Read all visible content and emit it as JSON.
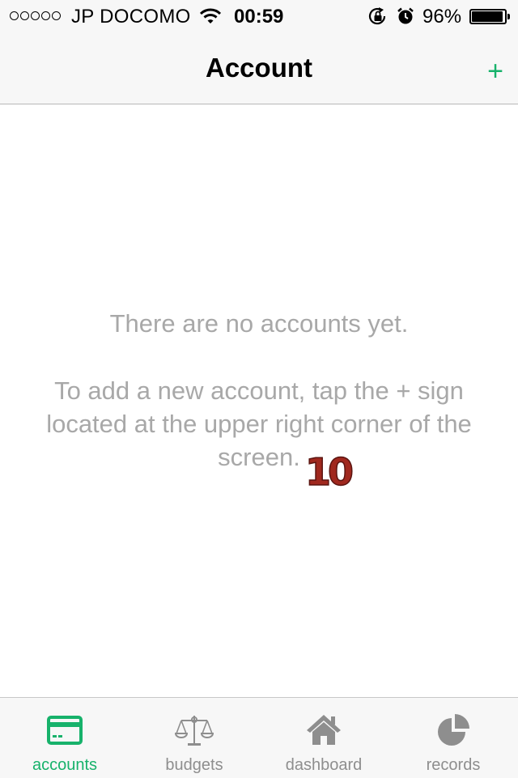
{
  "status_bar": {
    "carrier": "JP DOCOMO",
    "time": "00:59",
    "battery_percent": "96%",
    "battery_level": 0.96,
    "icons": [
      "signal-dots",
      "wifi-icon",
      "rotation-lock-icon",
      "alarm-icon",
      "battery-icon"
    ]
  },
  "nav": {
    "title": "Account",
    "add_label": "+"
  },
  "empty_state": {
    "line1": "There are no accounts yet.",
    "line2": "To add a new account, tap the + sign located at the upper right corner of the screen.",
    "annotation": "10"
  },
  "tabs": [
    {
      "label": "accounts",
      "icon": "credit-card-icon",
      "active": true
    },
    {
      "label": "budgets",
      "icon": "scales-icon",
      "active": false
    },
    {
      "label": "dashboard",
      "icon": "house-icon",
      "active": false
    },
    {
      "label": "records",
      "icon": "pie-chart-icon",
      "active": false
    }
  ],
  "colors": {
    "accent": "#17b26b",
    "inactive": "#8e8e8e",
    "empty_text": "#a8a8a8",
    "annotation": "#a0281e"
  }
}
